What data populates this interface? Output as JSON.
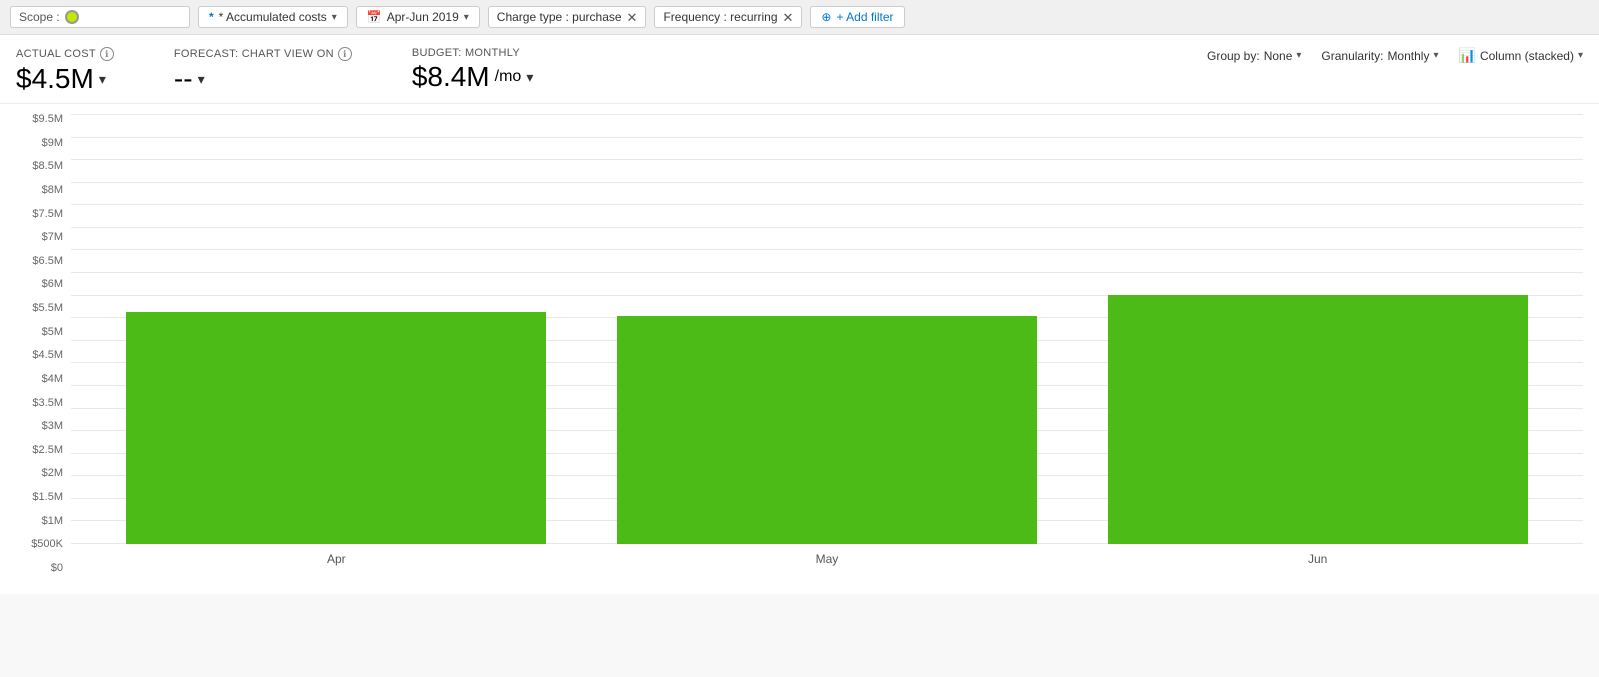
{
  "toolbar": {
    "scope_label": "Scope :",
    "accumulated_costs_label": "* Accumulated costs",
    "date_range_label": "Apr-Jun 2019",
    "charge_type_label": "Charge type : purchase",
    "frequency_label": "Frequency : recurring",
    "add_filter_label": "+ Add filter",
    "calendar_icon": "📅"
  },
  "metrics": {
    "actual_cost": {
      "label": "ACTUAL COST",
      "value": "$4.5M",
      "has_info": true,
      "has_chevron": true
    },
    "forecast": {
      "label": "FORECAST: CHART VIEW ON",
      "value": "--",
      "has_info": true,
      "has_chevron": true
    },
    "budget": {
      "label": "BUDGET: MONTHLY",
      "value": "$8.4M",
      "unit": "/mo",
      "has_chevron": true
    }
  },
  "chart_controls": {
    "group_by_label": "Group by:",
    "group_by_value": "None",
    "granularity_label": "Granularity:",
    "granularity_value": "Monthly",
    "view_label": "Column (stacked)"
  },
  "y_axis": {
    "labels": [
      "$0",
      "$500K",
      "$1M",
      "$1.5M",
      "$2M",
      "$2.5M",
      "$3M",
      "$3.5M",
      "$4M",
      "$4.5M",
      "$5M",
      "$5.5M",
      "$6M",
      "$6.5M",
      "$7M",
      "$7.5M",
      "$8M",
      "$8.5M",
      "$9M",
      "$9.5M"
    ]
  },
  "bars": [
    {
      "month": "Apr",
      "height_pct": 54,
      "color": "#4cbb17"
    },
    {
      "month": "May",
      "height_pct": 53,
      "color": "#4cbb17"
    },
    {
      "month": "Jun",
      "height_pct": 58,
      "color": "#4cbb17"
    }
  ],
  "colors": {
    "accent": "#0078d4",
    "bar_green": "#4cbb17",
    "grid_line": "#e8e8e8",
    "scope_dot": "#c5e800"
  }
}
